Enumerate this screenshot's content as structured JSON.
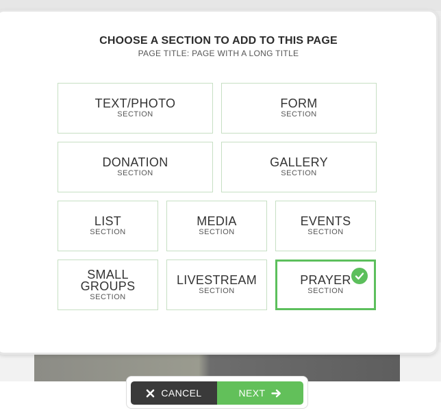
{
  "modal": {
    "title": "CHOOSE A SECTION TO ADD TO THIS PAGE",
    "subtitle": "PAGE TITLE: PAGE WITH A LONG TITLE"
  },
  "sections": [
    {
      "name": "TEXT/PHOTO",
      "sub": "SECTION",
      "selected": false
    },
    {
      "name": "FORM",
      "sub": "SECTION",
      "selected": false
    },
    {
      "name": "DONATION",
      "sub": "SECTION",
      "selected": false
    },
    {
      "name": "GALLERY",
      "sub": "SECTION",
      "selected": false
    },
    {
      "name": "LIST",
      "sub": "SECTION",
      "selected": false
    },
    {
      "name": "MEDIA",
      "sub": "SECTION",
      "selected": false
    },
    {
      "name": "EVENTS",
      "sub": "SECTION",
      "selected": false
    },
    {
      "name": "SMALL GROUPS",
      "sub": "SECTION",
      "selected": false
    },
    {
      "name": "LIVESTREAM",
      "sub": "SECTION",
      "selected": false
    },
    {
      "name": "PRAYER",
      "sub": "SECTION",
      "selected": true
    }
  ],
  "footer": {
    "cancel_label": "CANCEL",
    "cancel_icon": "close-icon",
    "next_label": "NEXT",
    "next_icon": "arrow-right-icon"
  },
  "colors": {
    "accent": "#5cbf5c",
    "dark_button": "#3a3a3a",
    "tile_border": "#c6dfc3"
  }
}
